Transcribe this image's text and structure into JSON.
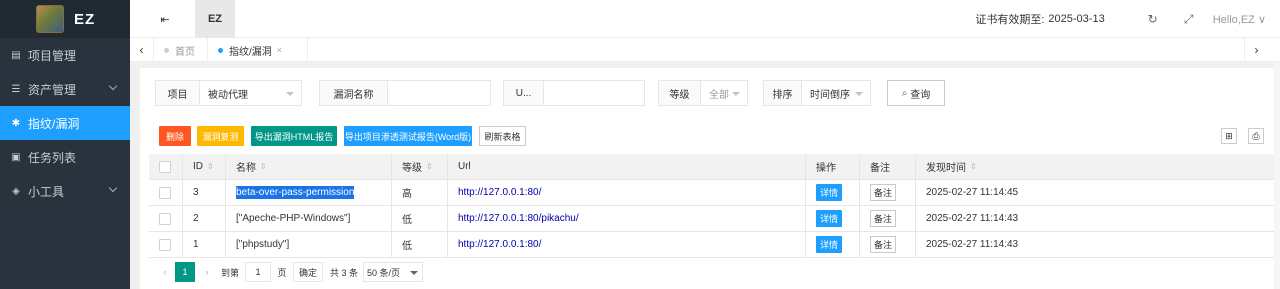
{
  "sidebar": {
    "brand": "EZ",
    "items": [
      {
        "label": "项目管理",
        "icon": "table-icon",
        "glyph": "▤",
        "active": false,
        "chevron": false
      },
      {
        "label": "资产管理",
        "icon": "list-icon",
        "glyph": "☰",
        "active": false,
        "chevron": true
      },
      {
        "label": "指纹/漏洞",
        "icon": "bug-icon",
        "glyph": "✱",
        "active": true,
        "chevron": false
      },
      {
        "label": "任务列表",
        "icon": "briefcase-icon",
        "glyph": "▣",
        "active": false,
        "chevron": false
      },
      {
        "label": "小工具",
        "icon": "cube-icon",
        "glyph": "◈",
        "active": false,
        "chevron": true
      }
    ]
  },
  "header": {
    "menu_icon": "⇤",
    "ez_label": "EZ",
    "cert_label": "证书有效期至:",
    "cert_date": "2025-03-13",
    "refresh_icon": "↻",
    "fullscreen_icon": "⤢",
    "hello": "Hello,EZ ∨"
  },
  "tabs": {
    "items": [
      {
        "label": "首页",
        "active": false
      },
      {
        "label": "指纹/漏洞",
        "active": true,
        "close": "×"
      }
    ],
    "left_arrow": "‹",
    "right_arrow": "›"
  },
  "filters": {
    "project_label": "项目",
    "project_value": "被动代理",
    "vuln_name_label": "漏洞名称",
    "vuln_name_value": "",
    "url_label": "U...",
    "url_value": "",
    "level_label": "等级",
    "level_value": "全部",
    "sort_label": "排序",
    "sort_value": "时间倒序",
    "search_label": "查询",
    "search_icon": "⌕"
  },
  "actions": {
    "delete": "删除",
    "vuln_review": "漏洞复测",
    "export_html": "导出漏洞HTML报告",
    "export_word": "导出项目渗透测试报告(Word版)",
    "refresh_table": "刷新表格",
    "columns_icon": "⊞",
    "print_icon": "⎙"
  },
  "colors": {
    "delete": "#ff5722",
    "vuln_review": "#ffb800",
    "export_html": "#009688",
    "export_word": "#1e9fff",
    "sidebar_bg": "#28333e",
    "active_nav": "#1e9fff"
  },
  "table": {
    "columns": {
      "id": "ID",
      "name": "名称",
      "level": "等级",
      "url": "Url",
      "op": "操作",
      "note": "备注",
      "time": "发现时间"
    },
    "sort_glyph": "⇕",
    "rows": [
      {
        "id": "3",
        "name": "beta-over-pass-permission",
        "level": "高",
        "url": "http://127.0.0.1:80/",
        "op": "详情",
        "note": "备注",
        "time": "2025-02-27 11:14:45",
        "selected": true
      },
      {
        "id": "2",
        "name": "[\"Apeche-PHP-Windows\"]",
        "level": "低",
        "url": "http://127.0.0.1:80/pikachu/",
        "op": "详情",
        "note": "备注",
        "time": "2025-02-27 11:14:43",
        "selected": false
      },
      {
        "id": "1",
        "name": "[\"phpstudy\"]",
        "level": "低",
        "url": "http://127.0.0.1:80/",
        "op": "详情",
        "note": "备注",
        "time": "2025-02-27 11:14:43",
        "selected": false
      }
    ]
  },
  "pager": {
    "prev": "‹",
    "current": "1",
    "next": "›",
    "goto_label": "到第",
    "goto_value": "1",
    "page_unit": "页",
    "confirm": "确定",
    "total": "共 3 条",
    "page_size": "50 条/页"
  }
}
